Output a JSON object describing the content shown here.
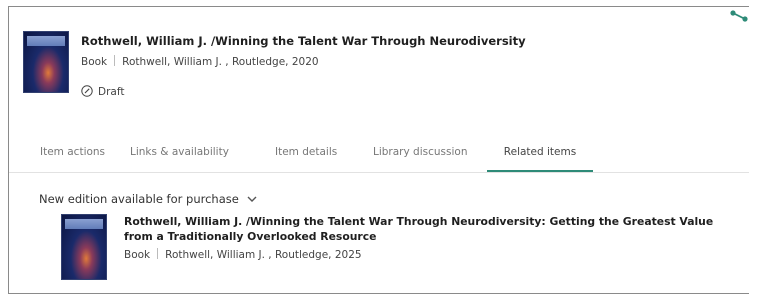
{
  "record": {
    "title": "Rothwell, William J. /Winning the Talent War Through Neurodiversity",
    "type": "Book",
    "details": "Rothwell, William J. , Routledge, 2020",
    "status": "Draft"
  },
  "tabs": [
    {
      "label": "Item actions"
    },
    {
      "label": "Links & availability"
    },
    {
      "label": "Item details"
    },
    {
      "label": "Library discussion"
    },
    {
      "label": "Related items",
      "active": true
    }
  ],
  "related": {
    "section_label": "New edition available for purchase",
    "item": {
      "title": "Rothwell, William J. /Winning the Talent War Through Neurodiversity: Getting the Greatest Value from a Traditionally Overlooked Resource",
      "type": "Book",
      "details": "Rothwell, William J. , Routledge, 2025"
    }
  },
  "icons": {
    "share": "share-icon",
    "draft": "edit-circle-icon",
    "chevron": "chevron-down-icon"
  },
  "colors": {
    "active_tab_underline": "#2e8b78",
    "share_icon": "#2e8b78"
  }
}
